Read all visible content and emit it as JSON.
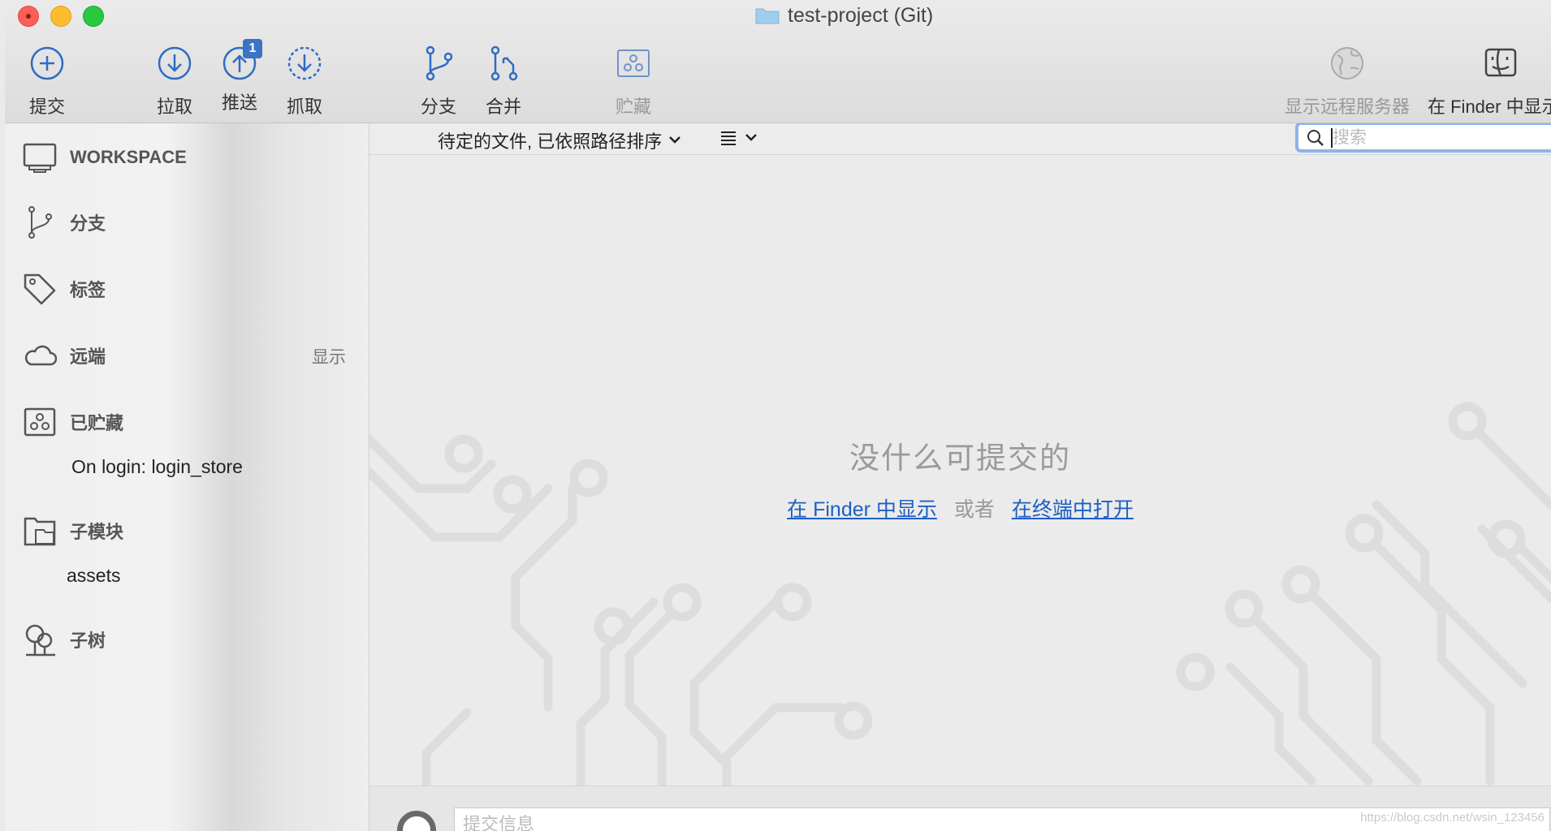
{
  "window": {
    "title": "test-project (Git)"
  },
  "toolbar": {
    "commit": "提交",
    "pull": "拉取",
    "push": "推送",
    "push_badge": "1",
    "fetch": "抓取",
    "branch": "分支",
    "merge": "合并",
    "stash": "贮藏",
    "show_remote": "显示远程服务器",
    "show_in_finder": "在 Finder 中显示"
  },
  "sidebar": {
    "workspace": "WORKSPACE",
    "branches": "分支",
    "tags": "标签",
    "remotes": "远端",
    "remotes_show": "显示",
    "stashes": "已贮藏",
    "stash_item": "On login: login_store",
    "submodules": "子模块",
    "submodule_item": "assets",
    "subtrees": "子树"
  },
  "main": {
    "sort_label": "待定的文件, 已依照路径排序",
    "search_placeholder": "搜索",
    "empty_title": "没什么可提交的",
    "link_finder": "在 Finder 中显示",
    "or": "或者",
    "link_terminal": "在终端中打开",
    "commit_placeholder": "提交信息"
  },
  "watermark": "https://blog.csdn.net/wsin_123456",
  "colors": {
    "accent": "#3b74c4",
    "link": "#1f5fc4",
    "search_focus": "#8db3ea"
  }
}
